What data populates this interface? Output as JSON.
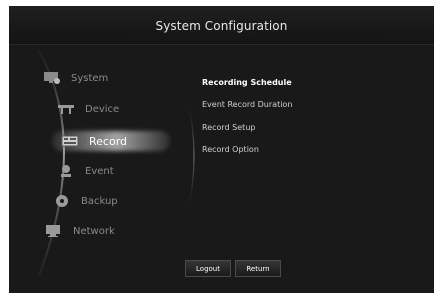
{
  "window": {
    "title": "System Configuration"
  },
  "menu": {
    "items": [
      {
        "label": "System",
        "icon": "monitor-settings-icon"
      },
      {
        "label": "Device",
        "icon": "device-icon"
      },
      {
        "label": "Record",
        "icon": "record-icon",
        "selected": true
      },
      {
        "label": "Event",
        "icon": "event-icon"
      },
      {
        "label": "Backup",
        "icon": "backup-disc-icon"
      },
      {
        "label": "Network",
        "icon": "network-icon"
      }
    ]
  },
  "submenu": {
    "items": [
      {
        "label": "Recording Schedule",
        "active": true
      },
      {
        "label": "Event Record Duration"
      },
      {
        "label": "Record Setup"
      },
      {
        "label": "Record Option"
      }
    ]
  },
  "footer": {
    "logout_label": "Logout",
    "return_label": "Return"
  },
  "colors": {
    "background": "#191919",
    "text_dim": "#8a8a8a",
    "text_bright": "#ffffff"
  }
}
